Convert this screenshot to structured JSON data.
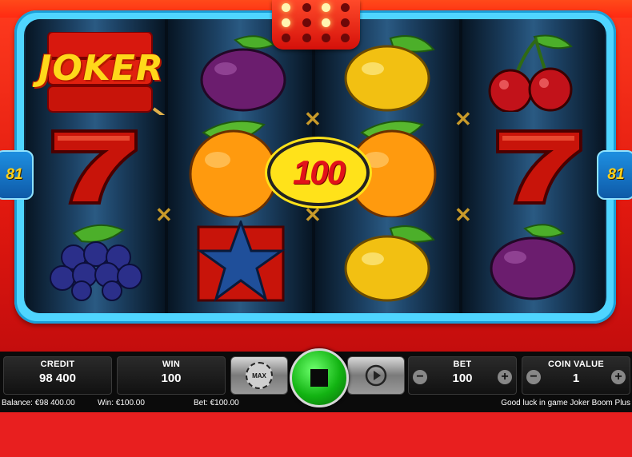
{
  "reels": {
    "side_left": "81",
    "side_right": "81",
    "win_amount": "100",
    "joker_logo": "JOKER",
    "symbols": [
      {
        "name": "joker-dynamite-symbol"
      },
      {
        "name": "plum-symbol"
      },
      {
        "name": "lemon-symbol"
      },
      {
        "name": "cherries-symbol"
      },
      {
        "name": "seven-symbol"
      },
      {
        "name": "orange-symbol"
      },
      {
        "name": "orange-symbol"
      },
      {
        "name": "seven-symbol"
      },
      {
        "name": "grapes-symbol"
      },
      {
        "name": "star-symbol"
      },
      {
        "name": "lemon-symbol"
      },
      {
        "name": "plum-symbol"
      }
    ],
    "dice_pattern": [
      true,
      false,
      true,
      false,
      true,
      false,
      false,
      false,
      false
    ],
    "colors": {
      "frame": "#4fd5ff",
      "cabinet": "#e81f1f",
      "badge": "#ffe21a"
    }
  },
  "panel": {
    "credit_label": "CREDIT",
    "credit_value": "98 400",
    "win_label": "WIN",
    "win_value": "100",
    "max_label": "MAX",
    "bet_label": "BET",
    "bet_value": "100",
    "coin_label": "COIN VALUE",
    "coin_value": "1",
    "minus": "−",
    "plus": "+"
  },
  "status": {
    "balance": "Balance: €98 400.00",
    "win": "Win: €100.00",
    "bet": "Bet: €100.00",
    "message": "Good luck in game Joker Boom Plus"
  }
}
